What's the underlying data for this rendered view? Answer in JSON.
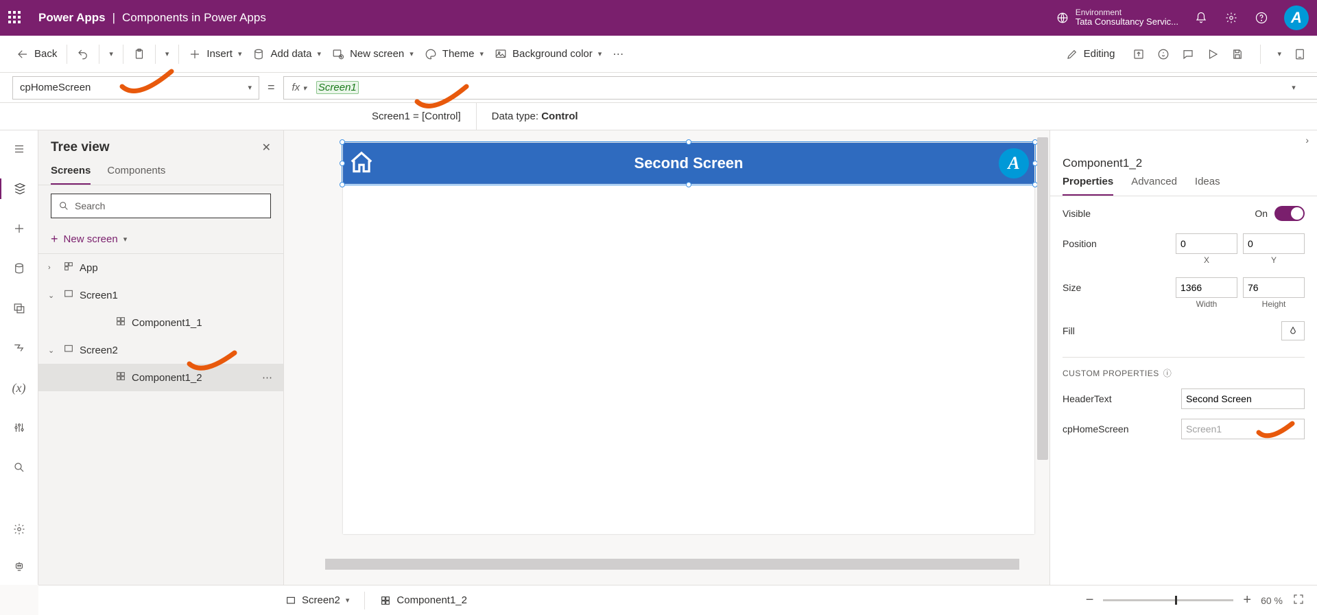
{
  "top": {
    "app": "Power Apps",
    "page": "Components in Power Apps",
    "env_label": "Environment",
    "env_name": "Tata Consultancy Servic...",
    "avatar": "A"
  },
  "cmd": {
    "back": "Back",
    "insert": "Insert",
    "add_data": "Add data",
    "new_screen": "New screen",
    "theme": "Theme",
    "bg_color": "Background color",
    "editing": "Editing"
  },
  "formula": {
    "property": "cpHomeScreen",
    "fx": "fx",
    "value": "Screen1",
    "result_left": "Screen1  =  [Control]",
    "result_label": "Data type:",
    "result_type": "Control"
  },
  "tree": {
    "title": "Tree view",
    "tab_screens": "Screens",
    "tab_components": "Components",
    "search_placeholder": "Search",
    "new_screen": "New screen",
    "items": {
      "app": "App",
      "screen1": "Screen1",
      "comp1_1": "Component1_1",
      "screen2": "Screen2",
      "comp1_2": "Component1_2"
    }
  },
  "canvas": {
    "header_title": "Second Screen"
  },
  "props": {
    "title": "Component1_2",
    "tab_props": "Properties",
    "tab_adv": "Advanced",
    "tab_ideas": "Ideas",
    "visible": "Visible",
    "visible_val": "On",
    "position": "Position",
    "pos_x": "0",
    "pos_y": "0",
    "lbl_x": "X",
    "lbl_y": "Y",
    "size": "Size",
    "size_w": "1366",
    "size_h": "76",
    "lbl_w": "Width",
    "lbl_h": "Height",
    "fill": "Fill",
    "custom_hdr": "CUSTOM PROPERTIES",
    "header_text_lbl": "HeaderText",
    "header_text_val": "Second Screen",
    "cphome_lbl": "cpHomeScreen",
    "cphome_val": "Screen1"
  },
  "status": {
    "screen": "Screen2",
    "sel": "Component1_2",
    "zoom": "60",
    "pct": "%"
  }
}
